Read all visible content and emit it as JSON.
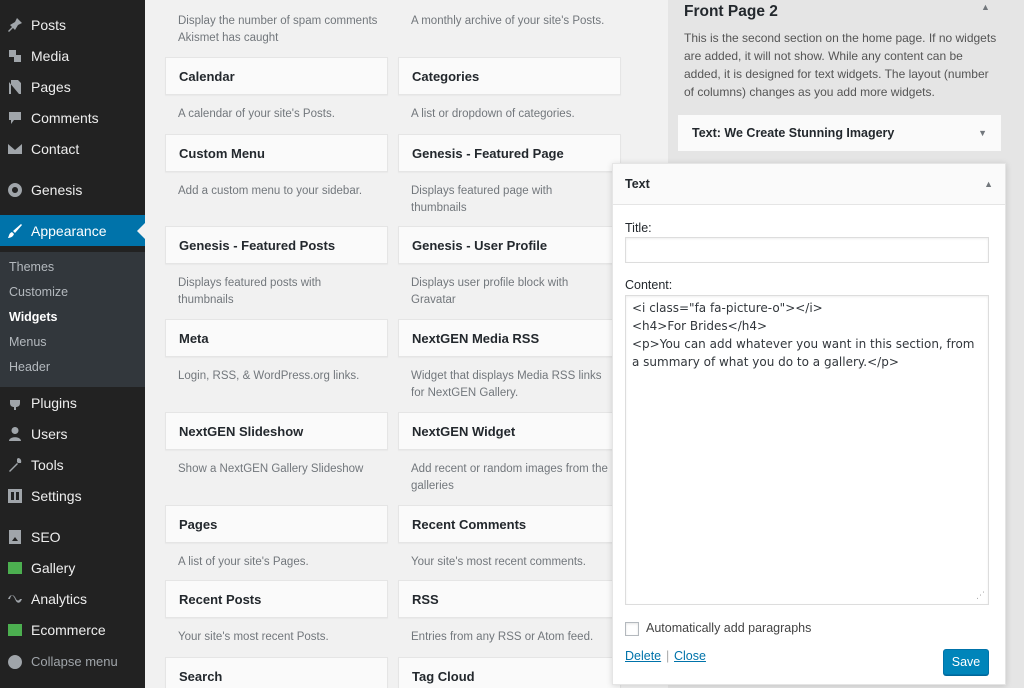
{
  "sidebar": {
    "menu": [
      {
        "label": "Posts",
        "icon": "pin-icon"
      },
      {
        "label": "Media",
        "icon": "media-icon"
      },
      {
        "label": "Pages",
        "icon": "pages-icon"
      },
      {
        "label": "Comments",
        "icon": "comments-icon"
      },
      {
        "label": "Contact",
        "icon": "mail-icon"
      },
      {
        "label": "Genesis",
        "icon": "genesis-icon"
      },
      {
        "label": "Appearance",
        "icon": "brush-icon"
      },
      {
        "label": "Plugins",
        "icon": "plug-icon"
      },
      {
        "label": "Users",
        "icon": "users-icon"
      },
      {
        "label": "Tools",
        "icon": "wrench-icon"
      },
      {
        "label": "Settings",
        "icon": "settings-icon"
      },
      {
        "label": "SEO",
        "icon": "seo-icon"
      },
      {
        "label": "Gallery",
        "icon": "gallery-icon"
      },
      {
        "label": "Analytics",
        "icon": "analytics-icon"
      },
      {
        "label": "Ecommerce",
        "icon": "ecommerce-icon"
      },
      {
        "label": "Collapse menu",
        "icon": "collapse-icon"
      }
    ],
    "submenu": [
      "Themes",
      "Customize",
      "Widgets",
      "Menus",
      "Header"
    ],
    "active_color": "#0073aa"
  },
  "widgets": {
    "top_descs": [
      "Display the number of spam comments Akismet has caught",
      "A monthly archive of your site's Posts."
    ],
    "items": [
      {
        "title": "Calendar",
        "desc": "A calendar of your site's Posts."
      },
      {
        "title": "Categories",
        "desc": "A list or dropdown of categories."
      },
      {
        "title": "Custom Menu",
        "desc": "Add a custom menu to your sidebar."
      },
      {
        "title": "Genesis - Featured Page",
        "desc": "Displays featured page with thumbnails"
      },
      {
        "title": "Genesis - Featured Posts",
        "desc": "Displays featured posts with thumbnails"
      },
      {
        "title": "Genesis - User Profile",
        "desc": "Displays user profile block with Gravatar"
      },
      {
        "title": "Meta",
        "desc": "Login, RSS, & WordPress.org links."
      },
      {
        "title": "NextGEN Media RSS",
        "desc": "Widget that displays Media RSS links for NextGEN Gallery."
      },
      {
        "title": "NextGEN Slideshow",
        "desc": "Show a NextGEN Gallery Slideshow"
      },
      {
        "title": "NextGEN Widget",
        "desc": "Add recent or random images from the galleries"
      },
      {
        "title": "Pages",
        "desc": "A list of your site's Pages."
      },
      {
        "title": "Recent Comments",
        "desc": "Your site's most recent comments."
      },
      {
        "title": "Recent Posts",
        "desc": "Your site's most recent Posts."
      },
      {
        "title": "RSS",
        "desc": "Entries from any RSS or Atom feed."
      },
      {
        "title": "Search",
        "desc": ""
      },
      {
        "title": "Tag Cloud",
        "desc": ""
      }
    ]
  },
  "front_page": {
    "title": "Front Page 2",
    "description": "This is the second section on the home page. If no widgets are added, it will not show. While any content can be added, it is designed for text widgets. The layout (number of columns) changes as you add more widgets.",
    "collapsed_widget_type": "Text",
    "collapsed_widget_title": "We Create Stunning Imagery"
  },
  "panel": {
    "header": "Text",
    "title_label": "Title:",
    "title_value": "",
    "content_label": "Content:",
    "content_value": "<i class=\"fa fa-picture-o\"></i>\n<h4>For Brides</h4>\n<p>You can add whatever you want in this section, from a summary of what you do to a gallery.</p>",
    "autop_label": "Automatically add paragraphs",
    "autop_checked": false,
    "delete_label": "Delete",
    "separator": "|",
    "close_label": "Close",
    "save_label": "Save"
  }
}
